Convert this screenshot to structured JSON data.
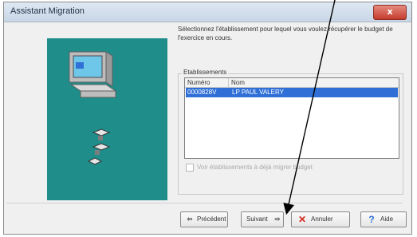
{
  "window": {
    "title": "Assistant Migration",
    "close_label": "x"
  },
  "intro": {
    "text": "Sélectionnez l'établissement pour lequel vous voulez récupérer le budget de l'exercice en cours."
  },
  "establishments": {
    "group_label": "Etablissements",
    "columns": [
      "Numéro",
      "Nom"
    ],
    "rows": [
      {
        "numero": "0000828V",
        "nom": "LP PAUL VALERY",
        "selected": true
      }
    ],
    "checkbox_label": "Voir établissements à déjà migrer budget"
  },
  "buttons": {
    "previous": "Précédent",
    "next": "Suivant",
    "cancel": "Annuler",
    "help": "Aide"
  },
  "colors": {
    "side_panel": "#1f8d8a",
    "selection": "#2f6fd6",
    "cancel_x": "#d42a1c",
    "help_question": "#2f6fd6"
  },
  "icons": {
    "side_computer": "computer-icon",
    "side_discs": "floppy-disk-icon",
    "previous": "back-arrow-icon",
    "next": "forward-arrow-icon",
    "cancel": "red-x-icon",
    "help": "question-mark-icon"
  }
}
